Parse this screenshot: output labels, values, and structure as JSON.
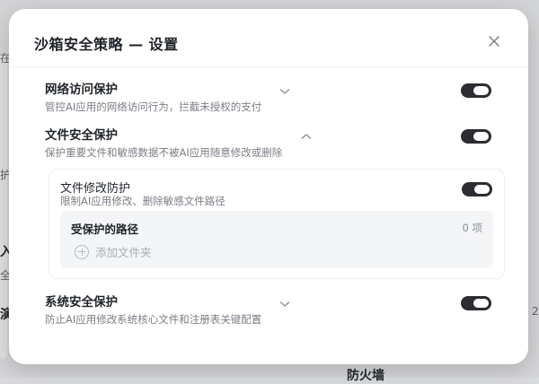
{
  "background": {
    "fragments": [
      "在访",
      "护",
      "入",
      "全",
      "演",
      "防火墙",
      "2"
    ]
  },
  "modal": {
    "title": "沙箱安全策略 — 设置",
    "sections": [
      {
        "title": "网络访问保护",
        "description": "管控AI应用的网络访问行为，拦截未授权的支付",
        "expanded": false,
        "enabled": true
      },
      {
        "title": "文件安全保护",
        "description": "保护重要文件和敏感数据不被AI应用随意修改或删除",
        "expanded": true,
        "enabled": true
      },
      {
        "title": "系统安全保护",
        "description": "防止AI应用修改系统核心文件和注册表关键配置",
        "expanded": false,
        "enabled": true
      }
    ],
    "file_modify": {
      "title": "文件修改防护",
      "description": "限制AI应用修改、删除敏感文件路径",
      "enabled": true,
      "protected_paths": {
        "title": "受保护的路径",
        "count": "0 项",
        "add_label": "添加文件夹"
      }
    }
  },
  "icons": {
    "close": "close-icon",
    "expand": "chevron-down-icon",
    "collapse": "chevron-up-icon",
    "add": "plus-circle-icon"
  },
  "colors": {
    "toggle_on": "#2b2d31",
    "backdrop": "#d9dadd",
    "panel_bg": "#f4f5f7"
  }
}
